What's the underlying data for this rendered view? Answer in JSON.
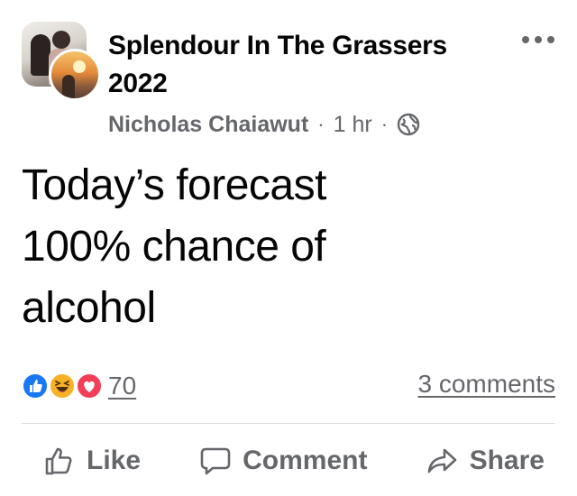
{
  "post": {
    "group_name": "Splendour In The Grassers 2022",
    "author": "Nicholas Chaiawut",
    "separator": "·",
    "time": "1 hr",
    "privacy_icon": "globe-icon",
    "more_icon": "more-horizontal-icon",
    "text_lines": [
      "Today’s forecast",
      "100% chance of",
      "alcohol"
    ]
  },
  "reactions": {
    "icons": [
      "like-reaction-icon",
      "haha-reaction-icon",
      "love-reaction-icon"
    ],
    "count": "70"
  },
  "comments": {
    "count_label": "3 comments"
  },
  "actions": {
    "like_label": "Like",
    "comment_label": "Comment",
    "share_label": "Share"
  },
  "colors": {
    "text_primary": "#050505",
    "text_secondary": "#65676b",
    "like_blue": "#1877f2",
    "love_red": "#f33e58",
    "haha_yellow": "#f7b125",
    "divider": "#dadde1"
  }
}
